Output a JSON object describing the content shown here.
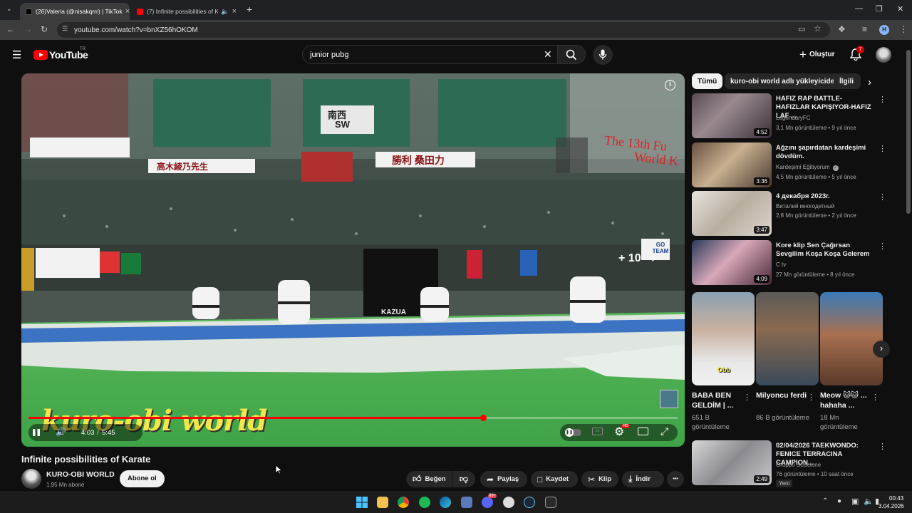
{
  "browser": {
    "tabs": [
      {
        "title": "(26)Valeria (@nisakqrrr) | TikTok",
        "close": "×"
      },
      {
        "title": "(7) Infinite possibilities of K",
        "close": "×"
      }
    ],
    "new_tab": "+",
    "url": "youtube.com/watch?v=bnXZ56hOKOM",
    "profile_initial": "H"
  },
  "header": {
    "logo_text": "YouTube",
    "region": "TR",
    "search_value": "junior pubg",
    "create_label": "Oluştur",
    "notification_count": "7"
  },
  "player": {
    "overlay_text": "kuro-obi world",
    "skip_label": "+ 10",
    "time_current": "4:03",
    "time_sep": "/",
    "time_total": "5:45",
    "progress": 0.7,
    "hd_badge": "HD",
    "banners": {
      "b1": "南西",
      "b2": "SW",
      "b3": "勝利  桑田力",
      "b4": "高木綾乃先生",
      "b5": "The 13th Fu",
      "b6": "World K",
      "b7": "KAZUA",
      "b8": "GO TEAM"
    }
  },
  "video": {
    "title": "Infinite possibilities of Karate",
    "channel": "KURO-OBI WORLD",
    "subscribers": "1,95 Mn abone",
    "subscribe": "Abone ol",
    "like": "Beğen",
    "share": "Paylaş",
    "save": "Kaydet",
    "clip": "Klip",
    "download": "İndir",
    "more": "•••"
  },
  "chips": [
    "Tümü",
    "kuro-obi world adlı yükleyiciden",
    "İlgili"
  ],
  "recommendations": [
    {
      "title": "HAFIZ RAP BATTLE-HAFIZLAR KAPIŞIYOR-HAFIZ LAF ...",
      "channel": "LegendaryFC",
      "meta": "3,1 Mn görüntüleme • 9 yıl önce",
      "duration": "4:52"
    },
    {
      "title": "Ağzını şapırdatan kardeşimi dövdüm.",
      "channel": "Kardeşimi Eğitiyorum",
      "meta": "4,5 Mn görüntüleme • 5 yıl önce",
      "duration": "3:36"
    },
    {
      "title": "4 декабря 2023г.",
      "channel": "Виталий многодетный",
      "meta": "2,8 Mn görüntüleme • 2 yıl önce",
      "duration": "3:47"
    },
    {
      "title": "Kore klip Sen Çağırsan Sevgilim Koşa Koşa Gelerem",
      "channel": "C tv",
      "meta": "27 Mn görüntüleme • 8 yıl önce",
      "duration": "4:09"
    }
  ],
  "shorts": [
    {
      "title": "BABA BEN GELDİM | ...",
      "views": "651 B görüntüleme",
      "caption": "Obb"
    },
    {
      "title": "Milyoncu ferdi",
      "views": "86 B görüntüleme"
    },
    {
      "title": "Meow 🐱🐱 ... hahaha ...",
      "views": "18 Mn görüntüleme"
    }
  ],
  "last_recommendation": {
    "title": "02/04/2026 TAEKWONDO: FENICE TERRACINA CAMPION...",
    "channel": "Gruppo Sciscione",
    "meta": "76 görüntüleme • 10 saat önce",
    "badge": "Yeni",
    "duration": "2:49"
  },
  "taskbar": {
    "time": "00:43",
    "date": "3.04.2026",
    "discord_badge": "99+"
  }
}
